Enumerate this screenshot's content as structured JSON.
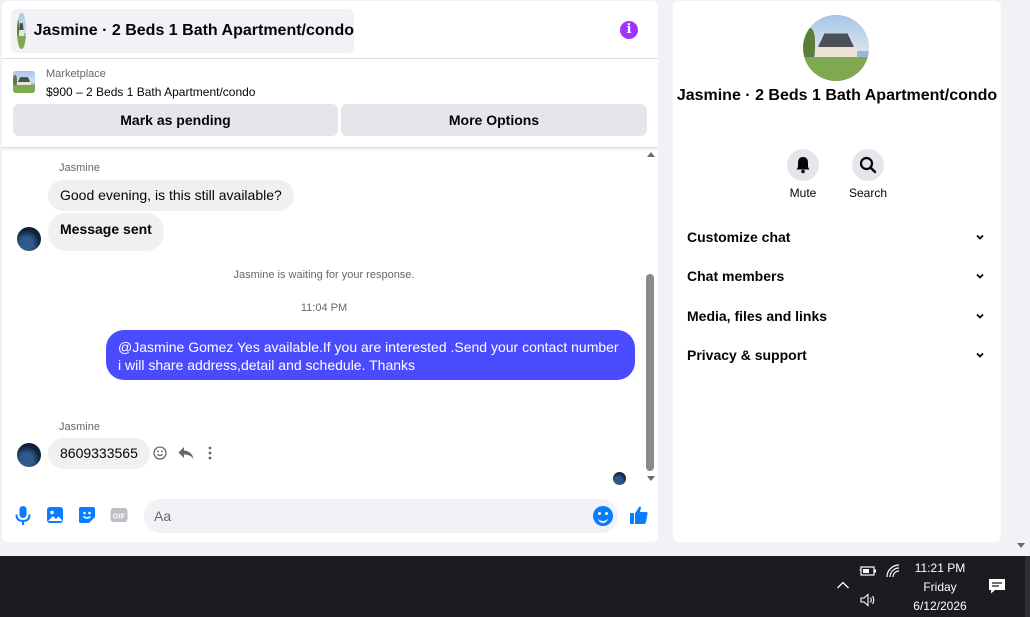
{
  "header": {
    "title": "Jasmine · 2 Beds 1 Bath Apartment/condo"
  },
  "listing": {
    "category": "Marketplace",
    "price_title": "$900 – 2 Beds 1 Bath Apartment/condo",
    "mark_pending_label": "Mark as pending",
    "more_options_label": "More Options"
  },
  "messages": {
    "sender_1": "Jasmine",
    "in_1": "Good evening, is this still available?",
    "in_2": "Message sent",
    "waiting_note": "Jasmine is waiting for your response.",
    "timestamp": "11:04 PM",
    "out_1": "@Jasmine Gomez  Yes available.If you are interested .Send your contact number i will share address,detail and schedule. Thanks",
    "sender_2": "Jasmine",
    "in_3": "8609333565"
  },
  "composer": {
    "placeholder": "Aa"
  },
  "info_panel": {
    "title": "Jasmine · 2 Beds 1 Bath Apartment/condo",
    "mute_label": "Mute",
    "search_label": "Search",
    "sections": [
      {
        "label": "Customize chat"
      },
      {
        "label": "Chat members"
      },
      {
        "label": "Media, files and links"
      },
      {
        "label": "Privacy & support"
      }
    ]
  },
  "taskbar": {
    "time": "11:21 PM",
    "day": "Friday",
    "date": "6/12/2026"
  },
  "colors": {
    "accent": "#0a7cff",
    "outgoing_bubble": "#4a4aff",
    "info_icon": "#a033ff"
  }
}
